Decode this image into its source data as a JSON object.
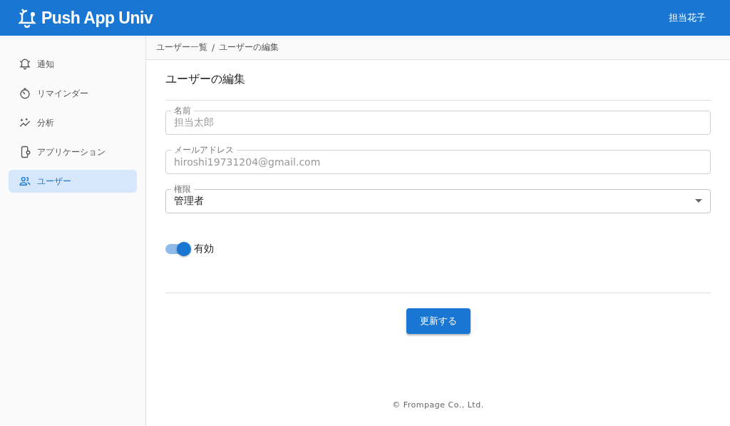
{
  "app_bar": {
    "title": "Push App Univ",
    "user": "担当花子"
  },
  "sidebar": {
    "items": [
      {
        "label": "通知",
        "selected": false
      },
      {
        "label": "リマインダー",
        "selected": false
      },
      {
        "label": "分析",
        "selected": false
      },
      {
        "label": "アプリケーション",
        "selected": false
      },
      {
        "label": "ユーザー",
        "selected": true
      }
    ]
  },
  "breadcrumb": {
    "separator": "/",
    "items": [
      "ユーザー一覧",
      "ユーザーの編集"
    ]
  },
  "form": {
    "title": "ユーザーの編集",
    "fields": [
      {
        "kind": "text",
        "label": "名前",
        "value": "担当太郎",
        "disabled": true
      },
      {
        "kind": "text",
        "label": "メールアドレス",
        "value": "hiroshi19731204@gmail.com",
        "disabled": true
      },
      {
        "kind": "select",
        "label": "権限",
        "value": "管理者",
        "disabled": false
      }
    ],
    "switch": {
      "label": "有効",
      "on": true
    },
    "submit": "更新する"
  },
  "footer": "© Frompage Co., Ltd."
}
